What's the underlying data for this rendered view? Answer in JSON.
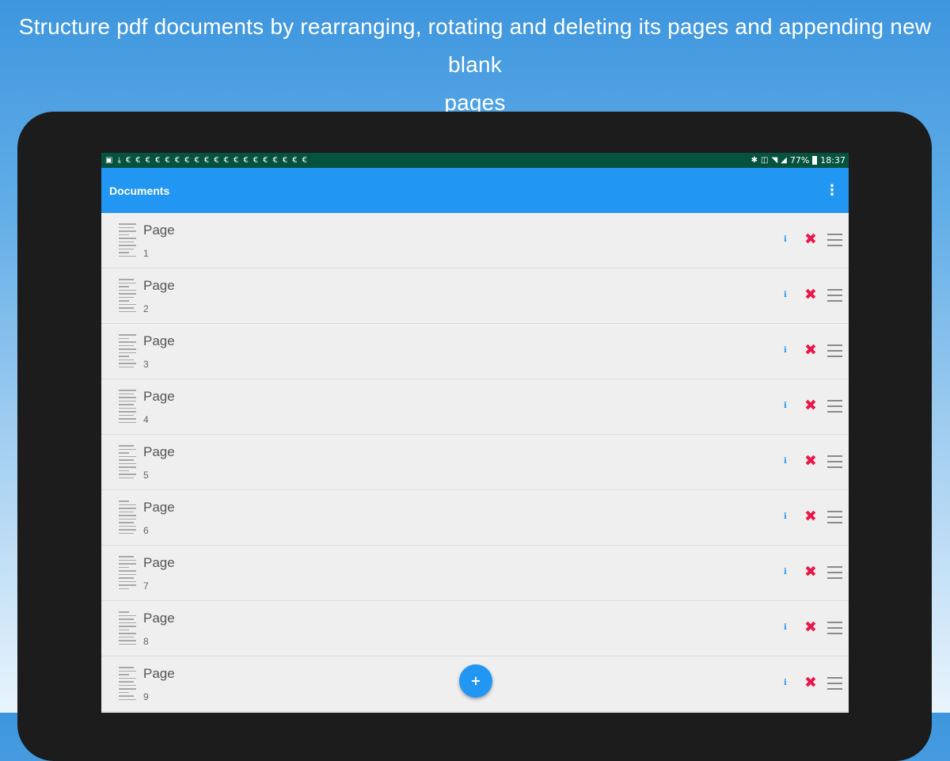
{
  "promo": {
    "line1": "Structure pdf documents by rearranging, rotating and deleting its pages and appending new blank",
    "line2": "pages"
  },
  "statusbar": {
    "time": "18:37",
    "battery": "77%",
    "notification_count": 19
  },
  "appbar": {
    "title": "Documents",
    "overflow_icon": "more-vert-icon"
  },
  "pages": [
    {
      "label": "Page",
      "number": "1"
    },
    {
      "label": "Page",
      "number": "2"
    },
    {
      "label": "Page",
      "number": "3"
    },
    {
      "label": "Page",
      "number": "4"
    },
    {
      "label": "Page",
      "number": "5"
    },
    {
      "label": "Page",
      "number": "6"
    },
    {
      "label": "Page",
      "number": "7"
    },
    {
      "label": "Page",
      "number": "8"
    },
    {
      "label": "Page",
      "number": "9"
    }
  ],
  "row_actions": {
    "info_icon": "info-icon",
    "delete_icon": "close-icon",
    "drag_icon": "drag-handle-icon"
  },
  "fab": {
    "icon": "plus-icon",
    "glyph": "+"
  },
  "colors": {
    "appbar": "#2196f3",
    "statusbar": "#05533f",
    "delete": "#e8174a",
    "info": "#2196f3"
  }
}
